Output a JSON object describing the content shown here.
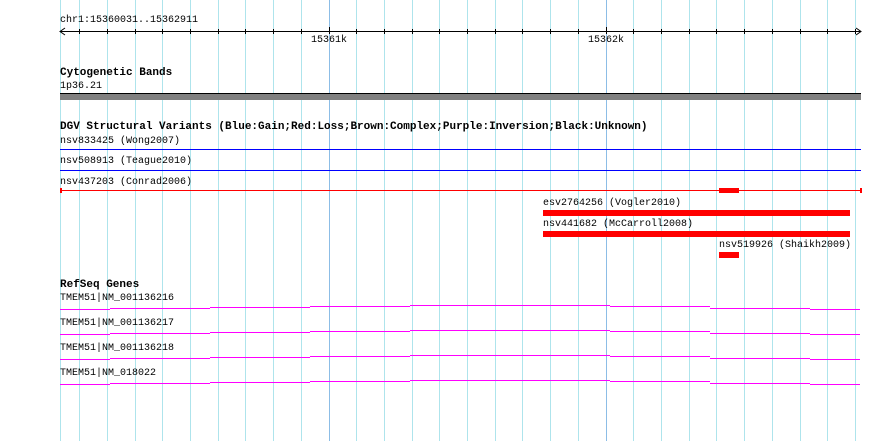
{
  "ruler": {
    "region_label": "chr1:15360031..15362911",
    "ticks": [
      "15361k",
      "15362k"
    ]
  },
  "tracks": {
    "cytobands": {
      "title": "Cytogenetic Bands",
      "band_label": "1p36.21",
      "band_color": "#808080"
    },
    "dgv": {
      "title": "DGV Structural Variants (Blue:Gain;Red:Loss;Brown:Complex;Purple:Inversion;Black:Unknown)",
      "features": [
        {
          "label": "nsv833425 (Wong2007)",
          "type": "Gain",
          "color": "#0000ff"
        },
        {
          "label": "nsv508913 (Teague2010)",
          "type": "Gain",
          "color": "#0000ff"
        },
        {
          "label": "nsv437203 (Conrad2006)",
          "type": "Loss",
          "color": "#ff0000"
        },
        {
          "label": "esv2764256 (Vogler2010)",
          "type": "Loss",
          "color": "#ff0000"
        },
        {
          "label": "nsv441682 (McCarroll2008)",
          "type": "Loss",
          "color": "#ff0000"
        },
        {
          "label": "nsv519926 (Shaikh2009)",
          "type": "Loss",
          "color": "#ff0000"
        }
      ]
    },
    "refseq": {
      "title": "RefSeq Genes",
      "color": "#ff00ff",
      "genes": [
        {
          "label": "TMEM51|NM_001136216"
        },
        {
          "label": "TMEM51|NM_001136217"
        },
        {
          "label": "TMEM51|NM_001136218"
        },
        {
          "label": "TMEM51|NM_018022"
        }
      ]
    }
  }
}
